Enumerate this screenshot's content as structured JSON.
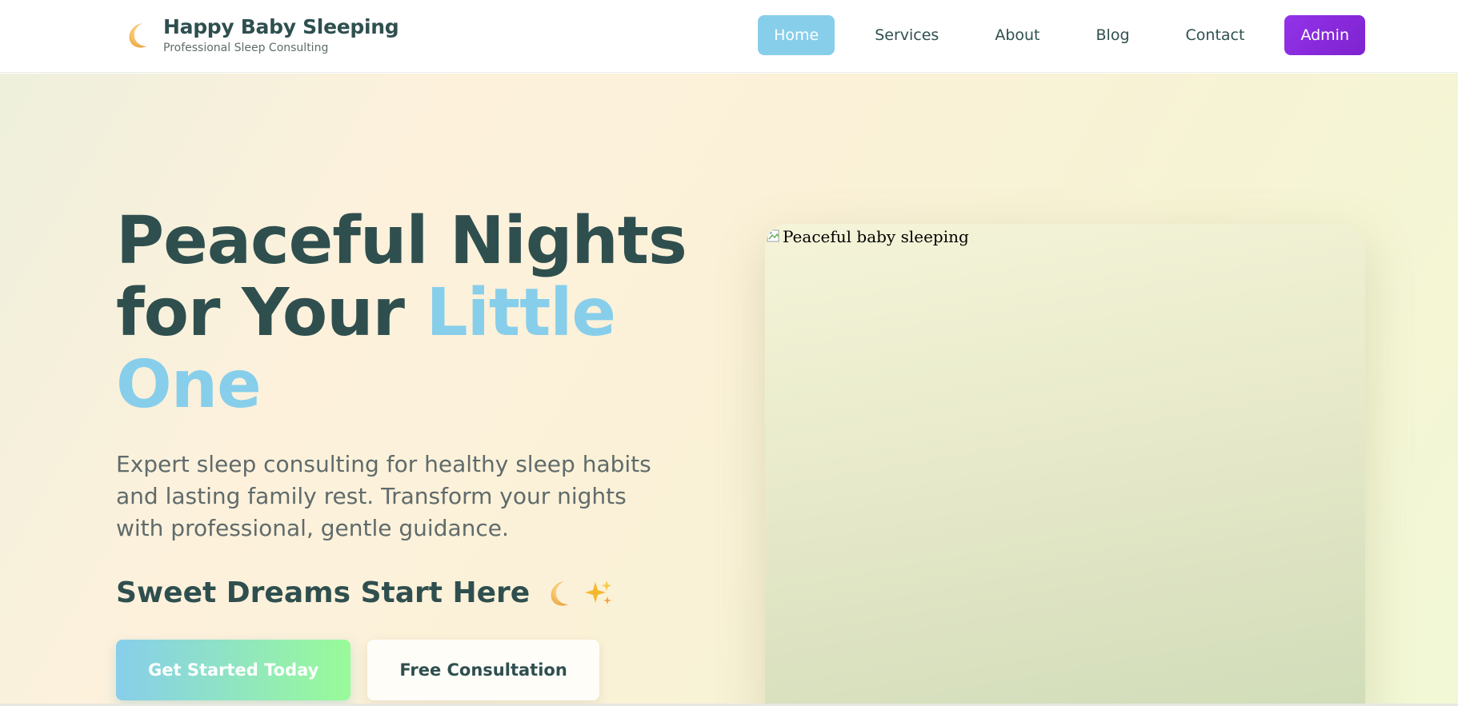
{
  "header": {
    "brand_title": "Happy Baby Sleeping",
    "brand_subtitle": "Professional Sleep Consulting",
    "brand_icon": "crescent-moon-icon",
    "nav": [
      {
        "label": "Home",
        "active": true
      },
      {
        "label": "Services",
        "active": false
      },
      {
        "label": "About",
        "active": false
      },
      {
        "label": "Blog",
        "active": false
      },
      {
        "label": "Contact",
        "active": false
      }
    ],
    "admin_label": "Admin"
  },
  "hero": {
    "title_line1": "Peaceful Nights",
    "title_line2": "for Your ",
    "title_accent_1": "Little",
    "title_accent_2": "One",
    "description": "Expert sleep consulting for healthy sleep habits and lasting family rest. Transform your nights with professional, gentle guidance.",
    "tagline": "Sweet Dreams Start Here",
    "tagline_icons": [
      "crescent-moon-icon",
      "sparkles-icon"
    ],
    "primary_cta": "Get Started Today",
    "secondary_cta": "Free Consultation",
    "image_alt": "Peaceful baby sleeping"
  },
  "colors": {
    "brand_dark": "#2f4f4f",
    "accent_blue": "#87ceeb",
    "accent_green": "#98fb98",
    "admin_purple": "#9333ea"
  }
}
